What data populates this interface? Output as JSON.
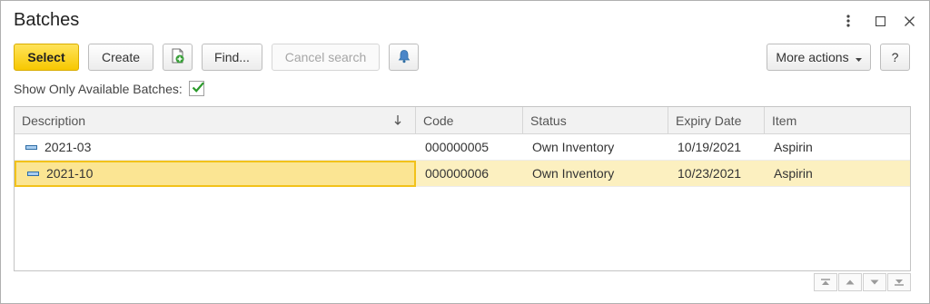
{
  "window": {
    "title": "Batches"
  },
  "toolbar": {
    "select_label": "Select",
    "create_label": "Create",
    "find_label": "Find...",
    "cancel_search_label": "Cancel search",
    "more_actions_label": "More actions",
    "help_label": "?"
  },
  "filter": {
    "label": "Show Only Available Batches:",
    "checked": true
  },
  "table": {
    "columns": [
      "Description",
      "Code",
      "Status",
      "Expiry Date",
      "Item"
    ],
    "sort_column": "Description",
    "sort_direction": "descending",
    "rows": [
      {
        "description": "2021-03",
        "code": "000000005",
        "status": "Own Inventory",
        "expiry_date": "10/19/2021",
        "item": "Aspirin"
      },
      {
        "description": "2021-10",
        "code": "000000006",
        "status": "Own Inventory",
        "expiry_date": "10/23/2021",
        "item": "Aspirin"
      }
    ],
    "selected_row": 1
  },
  "icons": [
    "kebab-menu-icon",
    "maximize-icon",
    "close-icon",
    "create-copy-icon",
    "bell-icon",
    "sort-arrow-icon",
    "row-marker-icon",
    "first-page-icon",
    "prev-page-icon",
    "next-page-icon",
    "last-page-icon"
  ],
  "colors": {
    "accent": "#f7c800",
    "selected_row": "#fcf0c0",
    "focus_cell": "#fbe593",
    "check": "#2a9a2a"
  }
}
